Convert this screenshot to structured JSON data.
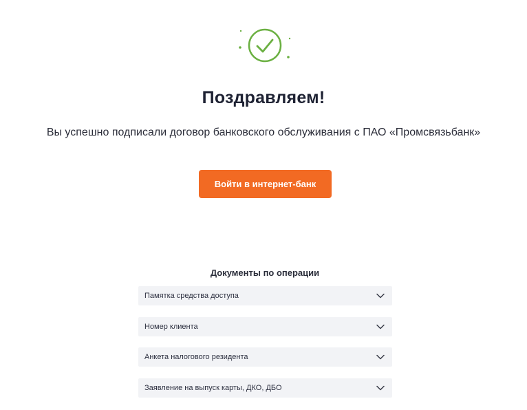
{
  "icons": {
    "success": "check-circle-icon",
    "chevron": "chevron-down-icon"
  },
  "colors": {
    "success_green": "#6bb042",
    "accent_orange": "#f26a23",
    "row_background": "#f2f3f6"
  },
  "success": {
    "title": "Поздравляем!",
    "message": "Вы успешно подписали договор банковского обслуживания с ПАО «Промсвязьбанк»"
  },
  "cta": {
    "label": "Войти в интернет-банк"
  },
  "documents": {
    "title": "Документы по операции",
    "items": [
      {
        "label": "Памятка средства доступа"
      },
      {
        "label": "Номер клиента"
      },
      {
        "label": "Анкета налогового резидента"
      },
      {
        "label": "Заявление на выпуск карты, ДКО, ДБО"
      }
    ]
  }
}
